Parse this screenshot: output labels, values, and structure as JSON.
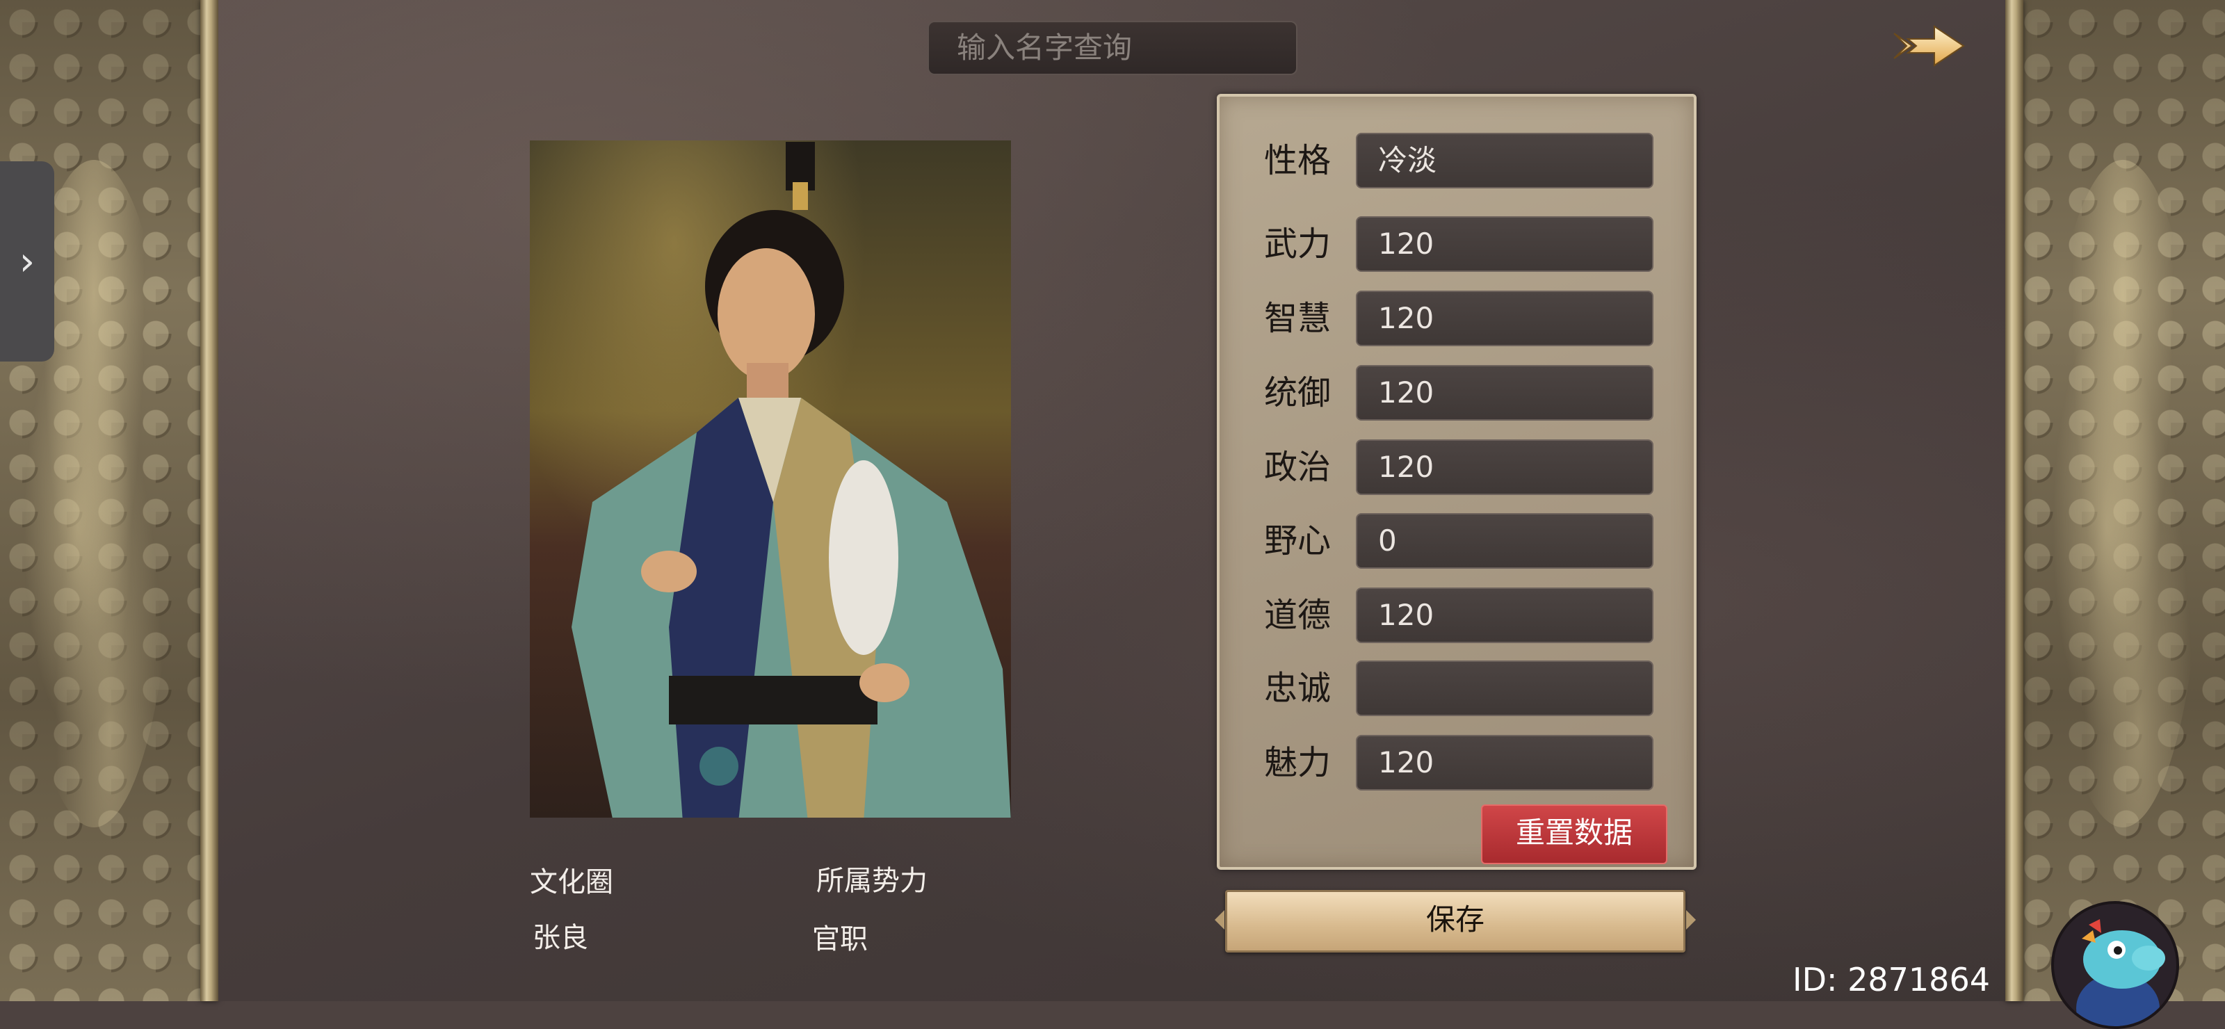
{
  "search": {
    "placeholder": "输入名字查询"
  },
  "attributes": [
    {
      "label": "性格",
      "value": "冷淡"
    },
    {
      "label": "武力",
      "value": "120"
    },
    {
      "label": "智慧",
      "value": "120"
    },
    {
      "label": "统御",
      "value": "120"
    },
    {
      "label": "政治",
      "value": "120"
    },
    {
      "label": "野心",
      "value": "0"
    },
    {
      "label": "道德",
      "value": "120"
    },
    {
      "label": "忠诚",
      "value": ""
    },
    {
      "label": "魅力",
      "value": "120"
    }
  ],
  "buttons": {
    "reset": "重置数据",
    "save": "保存"
  },
  "info": {
    "culture_label": "文化圈",
    "faction_label": "所属势力",
    "name": "张良",
    "office_label": "官职"
  },
  "user_id": "ID: 2871864",
  "icons": {
    "collapse": "chevron-right-icon",
    "next": "arrow-right-icon",
    "mascot": "dinosaur-mascot-icon"
  },
  "colors": {
    "reset_button": "#c03a3d",
    "save_button": "#dcc095",
    "panel": "#ab9c86"
  }
}
